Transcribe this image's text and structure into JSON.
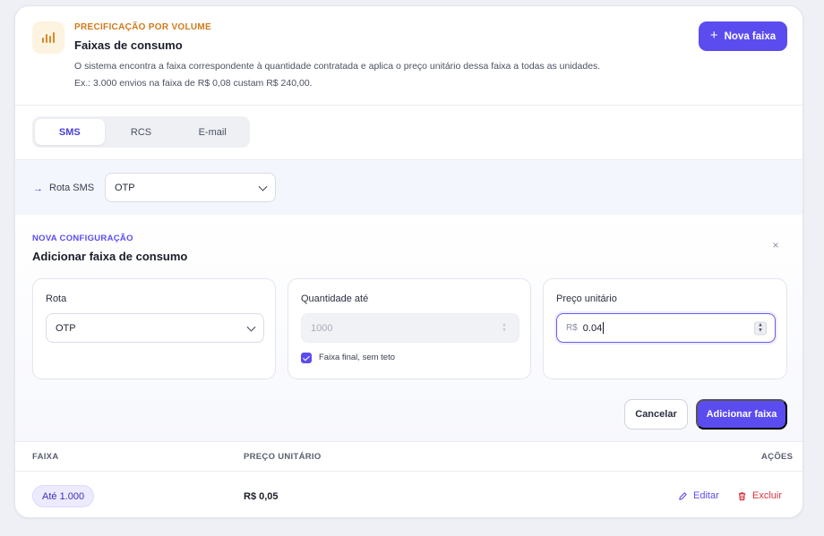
{
  "header": {
    "eyebrow": "PRECIFICAÇÃO POR VOLUME",
    "title": "Faixas de consumo",
    "description": "O sistema encontra a faixa correspondente à quantidade contratada e aplica o preço unitário dessa faixa a todas as unidades. Ex.: 3.000 envios na faixa de R$ 0,08 custam R$ 240,00.",
    "icon": "bar-chart-icon",
    "new_button_label": "Nova faixa"
  },
  "tabs": [
    {
      "label": "SMS",
      "active": true
    },
    {
      "label": "RCS",
      "active": false
    },
    {
      "label": "E-mail",
      "active": false
    }
  ],
  "route_bar": {
    "label": "Rota SMS",
    "selected": "OTP"
  },
  "new_config": {
    "eyebrow": "NOVA CONFIGURAÇÃO",
    "title": "Adicionar faixa de consumo",
    "close_label": "×",
    "route": {
      "label": "Rota",
      "selected": "OTP"
    },
    "quantity": {
      "label": "Quantidade até",
      "placeholder": "1000",
      "disabled": true,
      "checkbox_label": "Faixa final, sem teto",
      "checkbox_checked": true
    },
    "price": {
      "label": "Preço unitário",
      "prefix": "R$",
      "value": "0.04"
    },
    "cancel_label": "Cancelar",
    "submit_label": "Adicionar faixa"
  },
  "table": {
    "columns": [
      "FAIXA",
      "PREÇO UNITÁRIO",
      "AÇÕES"
    ],
    "rows": [
      {
        "range": "Até 1.000",
        "price": "R$ 0,05",
        "edit_label": "Editar",
        "delete_label": "Excluir"
      }
    ]
  },
  "colors": {
    "accent": "#5b4cf0",
    "warning": "#d27a1a",
    "danger": "#d9333f"
  }
}
